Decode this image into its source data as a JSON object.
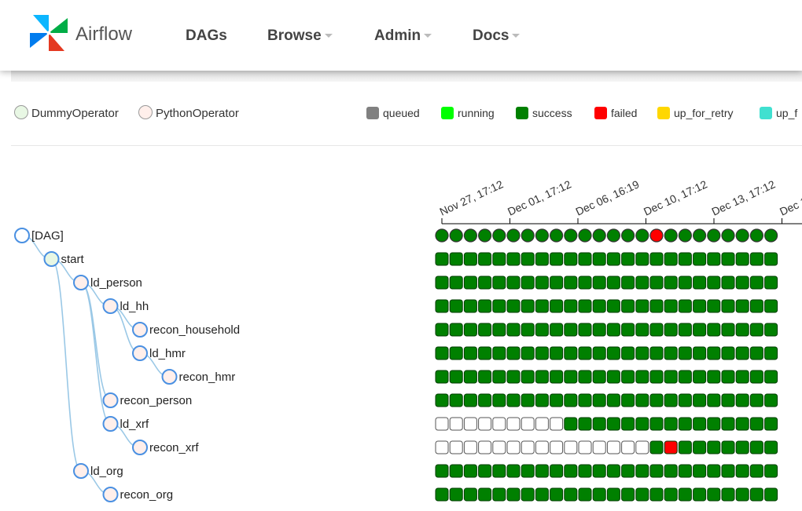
{
  "navbar": {
    "brand": "Airflow",
    "items": [
      {
        "label": "DAGs",
        "dropdown": false
      },
      {
        "label": "Browse",
        "dropdown": true
      },
      {
        "label": "Admin",
        "dropdown": true
      },
      {
        "label": "Docs",
        "dropdown": true
      }
    ]
  },
  "operator_legend": [
    {
      "label": "DummyOperator",
      "color": "#e8f7e4"
    },
    {
      "label": "PythonOperator",
      "color": "#ffefeb"
    }
  ],
  "state_legend": [
    {
      "label": "queued",
      "color": "#808080"
    },
    {
      "label": "running",
      "color": "#00ff00"
    },
    {
      "label": "success",
      "color": "#008000"
    },
    {
      "label": "failed",
      "color": "#ff0000"
    },
    {
      "label": "up_for_retry",
      "color": "#ffd700"
    },
    {
      "label": "up_f",
      "color": "#40e0d0"
    }
  ],
  "dates": [
    "Nov 27, 17:12",
    "Dec 01, 17:12",
    "Dec 06, 16:19",
    "Dec 10, 17:12",
    "Dec 13, 17:12",
    "Dec 1"
  ],
  "tree": [
    {
      "label": "[DAG]",
      "depth": 0,
      "operator": "dag"
    },
    {
      "label": "start",
      "depth": 1,
      "operator": "dummy"
    },
    {
      "label": "ld_person",
      "depth": 2,
      "operator": "python"
    },
    {
      "label": "ld_hh",
      "depth": 3,
      "operator": "python"
    },
    {
      "label": "recon_household",
      "depth": 4,
      "operator": "python"
    },
    {
      "label": "ld_hmr",
      "depth": 4,
      "operator": "python"
    },
    {
      "label": "recon_hmr",
      "depth": 5,
      "operator": "python"
    },
    {
      "label": "recon_person",
      "depth": 3,
      "operator": "python"
    },
    {
      "label": "ld_xrf",
      "depth": 3,
      "operator": "python"
    },
    {
      "label": "recon_xrf",
      "depth": 4,
      "operator": "python"
    },
    {
      "label": "ld_org",
      "depth": 2,
      "operator": "python"
    },
    {
      "label": "recon_org",
      "depth": 3,
      "operator": "python"
    }
  ],
  "grid_states": [
    "SSSSSSSSSSSSSSSFSSSSSSSS",
    "SSSSSSSSSSSSSSSSSSSSSSSS",
    "SSSSSSSSSSSSSSSSSSSSSSSS",
    "SSSSSSSSSSSSSSSSSSSSSSSS",
    "SSSSSSSSSSSSSSSSSSSSSSSS",
    "SSSSSSSSSSSSSSSSSSSSSSSS",
    "SSSSSSSSSSSSSSSSSSSSSSSS",
    "SSSSSSSSSSSSSSSSSSSSSSSS",
    "NNNNNNNNNSSSSSSSSSSSSSSS",
    "NNNNNNNNNNNNNNNSFSSSSSSS",
    "SSSSSSSSSSSSSSSSSSSSSSSS",
    "SSSSSSSSSSSSSSSSSSSSSSSS"
  ]
}
